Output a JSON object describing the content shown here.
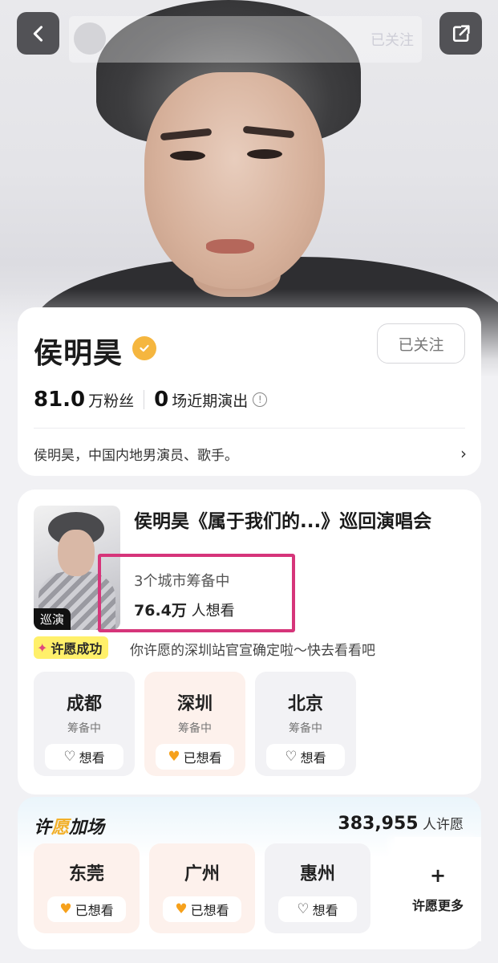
{
  "header": {
    "mini_follow_label": "已关注"
  },
  "profile": {
    "name": "侯明昊",
    "follow_label": "已关注",
    "fans_num": "81.0",
    "fans_label": "万粉丝",
    "shows_num": "0",
    "shows_label": "场近期演出",
    "bio": "侯明昊，中国内地男演员、歌手。"
  },
  "tour": {
    "poster_tag": "巡演",
    "title": "侯明昊《属于我们的...》巡回演唱会",
    "cities_preparing": "3个城市筹备中",
    "want_num": "76.4万",
    "want_label": "人想看",
    "wish_badge": "许愿成功",
    "wish_message": "你许愿的深圳站官宣确定啦～快去看看吧",
    "cities": [
      {
        "name": "成都",
        "status": "筹备中",
        "button": "想看",
        "active": false
      },
      {
        "name": "深圳",
        "status": "筹备中",
        "button": "已想看",
        "active": true
      },
      {
        "name": "北京",
        "status": "筹备中",
        "button": "想看",
        "active": false
      }
    ]
  },
  "wish": {
    "title_a": "许",
    "title_b": "愿",
    "title_c": "加场",
    "count_num": "383,955",
    "count_label": "人许愿",
    "cities": [
      {
        "name": "东莞",
        "button": "已想看",
        "active": true
      },
      {
        "name": "广州",
        "button": "已想看",
        "active": true
      },
      {
        "name": "惠州",
        "button": "想看",
        "active": false
      }
    ],
    "more_label": "许愿更多"
  },
  "colors": {
    "highlight_border": "#d6357a",
    "accent_orange": "#f6a11c",
    "badge_yellow": "#fff06a"
  }
}
